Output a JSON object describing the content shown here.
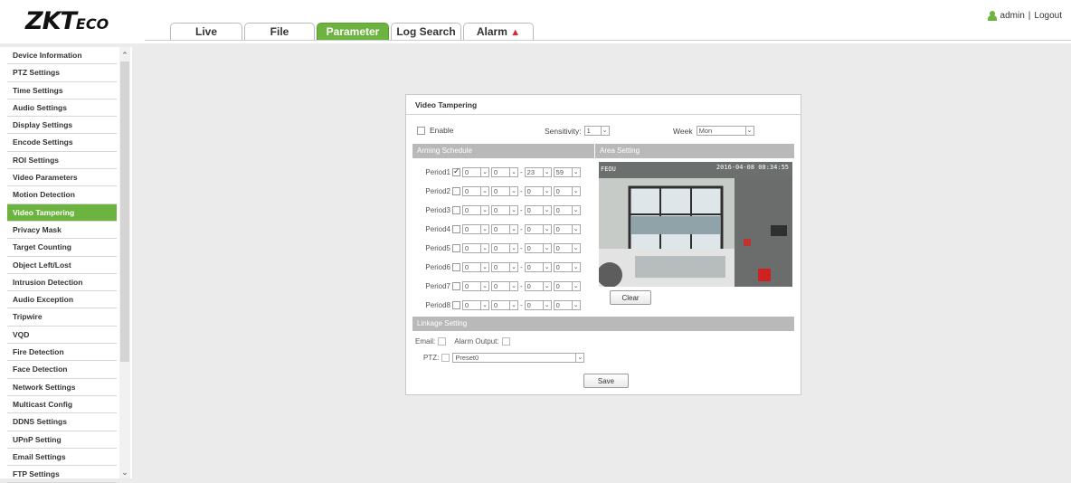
{
  "header": {
    "logo_main": "ZKT",
    "logo_sub": "ECO",
    "tabs": [
      {
        "label": "Live"
      },
      {
        "label": "File"
      },
      {
        "label": "Parameter"
      },
      {
        "label": "Log Search"
      },
      {
        "label": "Alarm"
      }
    ],
    "active_tab": "Parameter",
    "user": "admin",
    "separator": "|",
    "logout": "Logout",
    "accent_color": "#6db33f"
  },
  "sidebar": {
    "items": [
      {
        "label": "Device Information"
      },
      {
        "label": "PTZ Settings"
      },
      {
        "label": "Time Settings"
      },
      {
        "label": "Audio Settings"
      },
      {
        "label": "Display Settings"
      },
      {
        "label": "Encode Settings"
      },
      {
        "label": "ROI Settings"
      },
      {
        "label": "Video Parameters"
      },
      {
        "label": "Motion Detection"
      },
      {
        "label": "Video Tampering"
      },
      {
        "label": "Privacy Mask"
      },
      {
        "label": "Target Counting"
      },
      {
        "label": "Object Left/Lost"
      },
      {
        "label": "Intrusion Detection"
      },
      {
        "label": "Audio Exception"
      },
      {
        "label": "Tripwire"
      },
      {
        "label": "VQD"
      },
      {
        "label": "Fire Detection"
      },
      {
        "label": "Face Detection"
      },
      {
        "label": "Network Settings"
      },
      {
        "label": "Multicast Config"
      },
      {
        "label": "DDNS Settings"
      },
      {
        "label": "UPnP Setting"
      },
      {
        "label": "Email Settings"
      },
      {
        "label": "FTP Settings"
      }
    ],
    "active_item": "Video Tampering"
  },
  "panel": {
    "title": "Video Tampering",
    "enable_label": "Enable",
    "enable_checked": false,
    "sensitivity_label": "Sensitivity:",
    "sensitivity_value": "1",
    "week_label": "Week",
    "week_value": "Mon",
    "arming_schedule_label": "Arming Schedule",
    "area_setting_label": "Area Setting",
    "periods": [
      {
        "label": "Period1",
        "checked": true,
        "start_h": "0",
        "start_m": "0",
        "end_h": "23",
        "end_m": "59"
      },
      {
        "label": "Period2",
        "checked": false,
        "start_h": "0",
        "start_m": "0",
        "end_h": "0",
        "end_m": "0"
      },
      {
        "label": "Period3",
        "checked": false,
        "start_h": "0",
        "start_m": "0",
        "end_h": "0",
        "end_m": "0"
      },
      {
        "label": "Period4",
        "checked": false,
        "start_h": "0",
        "start_m": "0",
        "end_h": "0",
        "end_m": "0"
      },
      {
        "label": "Period5",
        "checked": false,
        "start_h": "0",
        "start_m": "0",
        "end_h": "0",
        "end_m": "0"
      },
      {
        "label": "Period6",
        "checked": false,
        "start_h": "0",
        "start_m": "0",
        "end_h": "0",
        "end_m": "0"
      },
      {
        "label": "Period7",
        "checked": false,
        "start_h": "0",
        "start_m": "0",
        "end_h": "0",
        "end_m": "0"
      },
      {
        "label": "Period8",
        "checked": false,
        "start_h": "0",
        "start_m": "0",
        "end_h": "0",
        "end_m": "0"
      }
    ],
    "clear_label": "Clear",
    "linkage_label": "Linkage Setting",
    "email_label": "Email:",
    "alarm_output_label": "Alarm Output:",
    "ptz_label": "PTZ:",
    "ptz_value": "Preset0",
    "save_label": "Save",
    "video_overlay_left": "FEOU",
    "video_overlay_right": "2016-04-08 08:34:55"
  }
}
